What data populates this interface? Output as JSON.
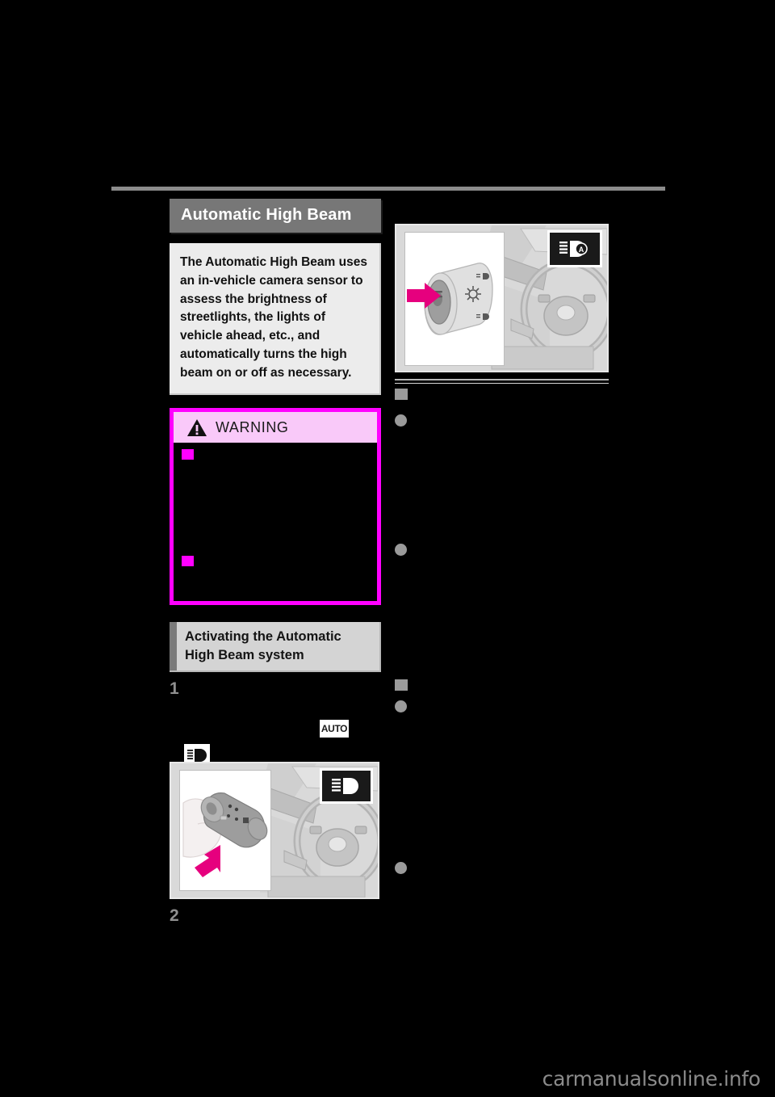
{
  "page": {
    "background_color": "#000000",
    "watermark": "carmanualsonline.info"
  },
  "left_column": {
    "section_title": "Automatic High Beam",
    "section_title_bg": "#777777",
    "intro_paragraph": "The Automatic High Beam uses an in-vehicle camera sensor to assess the brightness of streetlights, the lights of vehicle ahead, etc., and automatically turns the high beam on or off as necessary.",
    "warning": {
      "label": "WARNING",
      "icon": "warning-triangle-icon",
      "header_bg": "#f9c9f9",
      "border_color": "#ff00ff",
      "bullets": [
        "",
        ""
      ],
      "body_text": ""
    },
    "subsection": {
      "heading": "Activating the Automatic High Beam system",
      "steps": [
        {
          "number": "1",
          "text": "",
          "icons": [
            "auto-headlight-icon",
            "low-beam-headlight-icon"
          ]
        },
        {
          "number": "2",
          "text": ""
        }
      ]
    },
    "figure_lever": {
      "name": "headlight-lever-illustration",
      "badge_icon": "high-beam-indicator-icon",
      "arrow_color": "#e6007e"
    }
  },
  "right_column": {
    "figure_switch": {
      "name": "headlight-switch-dial-illustration",
      "badge_icon": "automatic-high-beam-indicator-icon",
      "arrow_color": "#e6007e"
    },
    "info_heading": "",
    "blocks": [
      {
        "marker": "square",
        "text": ""
      },
      {
        "marker": "dot",
        "text": ""
      },
      {
        "marker": "dot",
        "text": ""
      },
      {
        "marker": "square",
        "text": ""
      },
      {
        "marker": "dot",
        "text": ""
      },
      {
        "marker": "dot",
        "text": ""
      }
    ]
  },
  "icons": {
    "auto_label": "AUTO",
    "low_beam": "low-beam-headlight-icon",
    "high_beam": "high-beam-headlight-icon",
    "auto_high_beam": "automatic-high-beam-icon"
  }
}
